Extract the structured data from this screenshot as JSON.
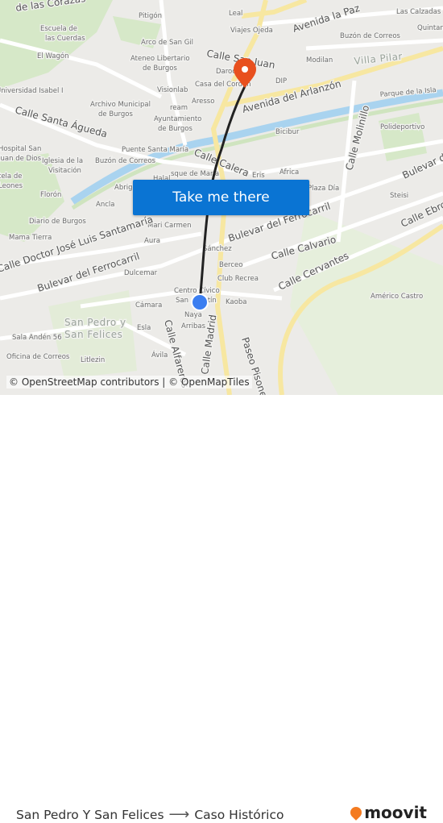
{
  "map": {
    "labels": [
      "de las Corazas",
      "Pitigón",
      "Leal",
      "Avenida la Paz",
      "Las Calzadas",
      "Escuela de",
      "las Cuerdas",
      "Arco de San Gil",
      "Viajes Ojeda",
      "Buzón de Correos",
      "Quintan",
      "El Wagón",
      "Ateneo Libertario",
      "de Burgos",
      "Calle San Juan",
      "Modilan",
      "Villa Pilar",
      "Universidad Isabel I",
      "Visionlab",
      "Daroca",
      "Casa del Cordón",
      "DIP",
      "Avenida del Arlanzón",
      "Parque de la Isla",
      "Archivo Municipal",
      "de Burgos",
      "ream",
      "Aresso",
      "Calle Santa Águeda",
      "Ayuntamiento",
      "de Burgos",
      "Bicibur",
      "Polideportivo",
      "Calle Molinillo",
      "Hospital San",
      "Juan de Dios",
      "Iglesia de la",
      "Visitación",
      "Puente Santa María",
      "Calle Calera",
      "Buzón de Correos",
      "sque de María",
      "Eris",
      "Africa",
      "Bulevar de",
      "Halal",
      "Abrigo",
      "Florón",
      "Plaza Día",
      "Steisi",
      "Ancla",
      "Calle Ebro",
      "Diario de Burgos",
      "Mari Carmen",
      "Bulevar del Ferrocarril",
      "Mama Tierra",
      "Aura",
      "Calle Doctor José Luis Santamaría",
      "Sánchez",
      "Calle Calvario",
      "Bulevar del Ferrocarril",
      "Berceo",
      "Dulcemar",
      "Club Recrea",
      "Calle Cervantes",
      "Centro Cívico",
      "San Agustín",
      "Kaoba",
      "Américo Castro",
      "Cámara",
      "Naya",
      "San Pedro y",
      "San Felices",
      "Esla",
      "Arribas",
      "Calle Alfareros",
      "Calle Madrid",
      "Paseo Pisones",
      "Sala Andén 56",
      "Oficina de Correos",
      "Ávila",
      "Litlezin",
      "Leones",
      "tela de"
    ],
    "origin_color": "#3b7ef0",
    "destination_color": "#e8501e",
    "route_color": "#222222"
  },
  "cta": {
    "label": "Take me there"
  },
  "attribution": "© OpenStreetMap contributors | © OpenMapTiles",
  "footer": {
    "from": "San Pedro Y San Felices",
    "arrow": "⟶",
    "to": "Caso Histórico",
    "brand": "moovit",
    "brand_color": "#f47b20"
  }
}
